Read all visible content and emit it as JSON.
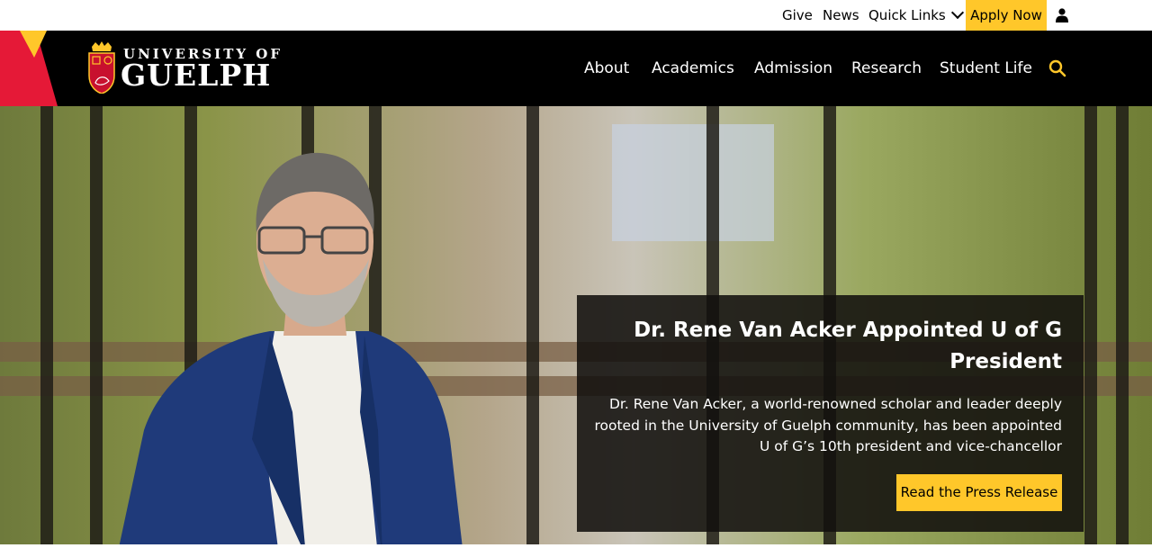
{
  "utility_nav": {
    "give": "Give",
    "news": "News",
    "quick_links": "Quick Links",
    "apply_now": "Apply Now",
    "user_icon": "user-icon"
  },
  "header": {
    "logo_line1": "UNIVERSITY OF",
    "logo_line2": "GUELPH",
    "nav": [
      "About",
      "Academics",
      "Admission",
      "Research",
      "Student Life"
    ],
    "search_icon": "search-icon"
  },
  "hero": {
    "title": "Dr. Rene Van Acker Appointed U of G President",
    "description": "Dr. Rene Van Acker, a world-renowned scholar and leader deeply rooted in the University of Guelph community, has been appointed U of G’s 10th president and vice-chancellor",
    "cta": "Read the Press Release"
  },
  "colors": {
    "accent_yellow": "#ffc72a",
    "accent_red": "#e51937",
    "header_bg": "#000000"
  }
}
